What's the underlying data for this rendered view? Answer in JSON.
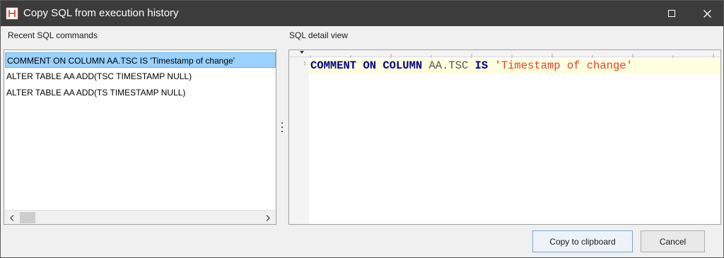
{
  "window": {
    "title": "Copy SQL from execution history"
  },
  "icons": {
    "app": "app-logo-icon",
    "maximize": "maximize-icon",
    "close": "close-icon",
    "scroll_left": "chevron-left-icon",
    "scroll_right": "chevron-right-icon",
    "splitter": "vertical-dots-icon"
  },
  "left_pane": {
    "label": "Recent SQL commands",
    "items": [
      "COMMENT ON COLUMN AA.TSC IS 'Timestamp of change'",
      "ALTER TABLE AA ADD(TSC TIMESTAMP NULL)",
      "ALTER TABLE AA ADD(TS TIMESTAMP NULL)"
    ],
    "selected_index": 0
  },
  "right_pane": {
    "label": "SQL detail view",
    "line_number": "1",
    "tokens": {
      "kw1": "COMMENT",
      "kw2": "ON",
      "kw3": "COLUMN",
      "ident": "AA.TSC",
      "kw4": "IS",
      "str": "'Timestamp of change'"
    }
  },
  "buttons": {
    "copy": "Copy to clipboard",
    "cancel": "Cancel"
  },
  "colors": {
    "titlebar": "#3c3c3c",
    "selection": "#99d1ff",
    "keyword": "#000080",
    "string": "#e8402a",
    "current_line": "#ffffe0"
  }
}
